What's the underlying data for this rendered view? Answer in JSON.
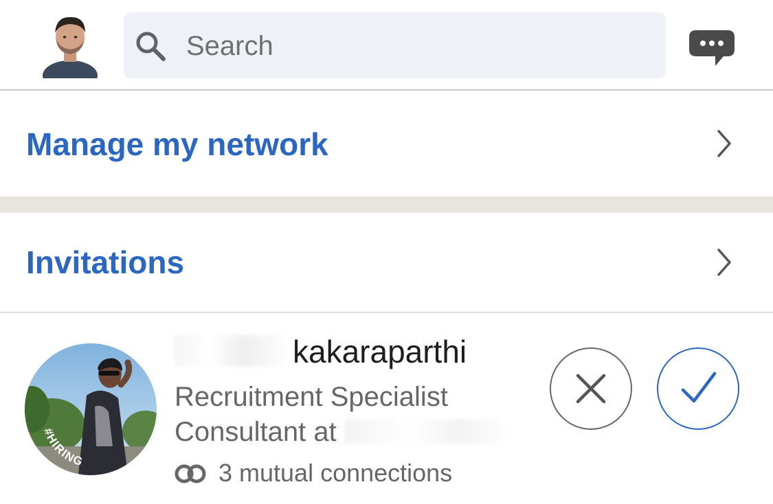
{
  "header": {
    "search": {
      "placeholder": "Search"
    },
    "icons": {
      "avatar": "user-avatar",
      "search": "search-icon",
      "messaging": "messaging-icon"
    }
  },
  "menu": {
    "manage_network": "Manage my network",
    "invitations": "Invitations"
  },
  "invitation": {
    "name_visible": "kakaraparthi",
    "headline_line1": "Recruitment Specialist",
    "headline_line2_visible": "Consultant at",
    "badge": "#HIRING",
    "mutual_connections": "3 mutual connections",
    "actions": {
      "ignore": "close-icon",
      "accept": "check-icon"
    }
  },
  "colors": {
    "accent": "#2a66c4",
    "muted_text": "#666666",
    "search_bg": "#eef2f7",
    "hiring_purple": "#7b3fc4",
    "band": "#e8e5de"
  }
}
